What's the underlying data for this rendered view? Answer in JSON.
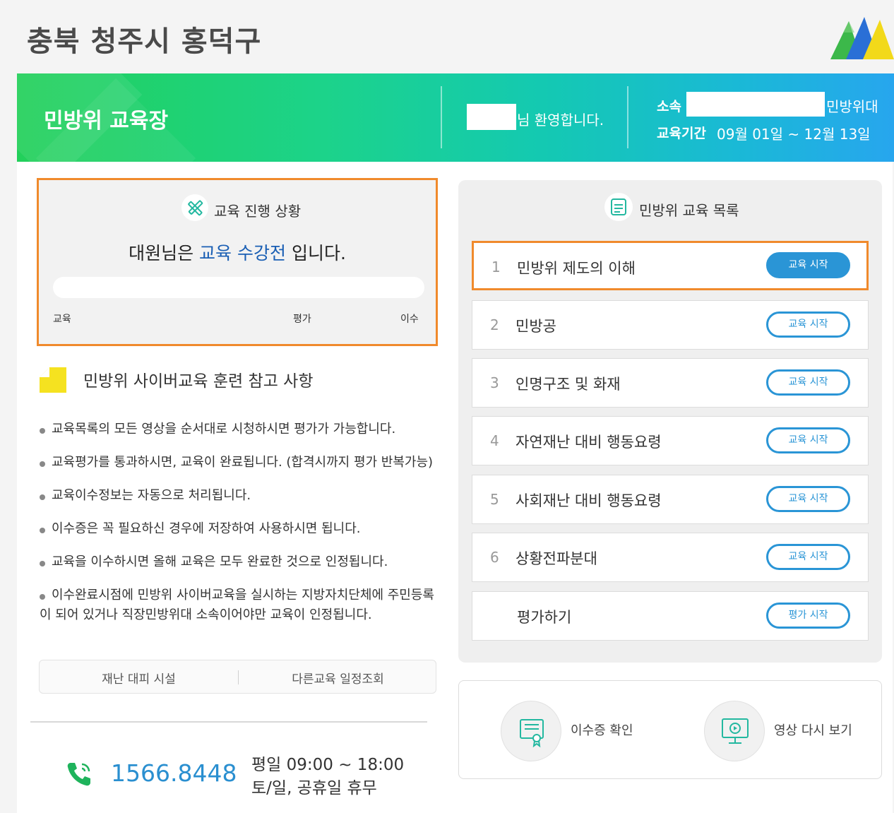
{
  "header": {
    "region": "충북 청주시 홍덕구"
  },
  "banner": {
    "title": "민방위 교육장",
    "welcome_suffix": "님 환영합니다.",
    "affiliation_label": "소속",
    "affiliation_suffix": "민방위대",
    "period_label": "교육기간",
    "period_value": "09월 01일 ~ 12월 13일"
  },
  "progress": {
    "title": "교육 진행 상황",
    "status_prefix": "대원님은 ",
    "status_highlight": "교육 수강전",
    "status_suffix": " 입니다.",
    "fraction": 0,
    "steps": [
      "교육",
      "평가",
      "이수"
    ]
  },
  "notes": {
    "title": "민방위 사이버교육 훈련 참고 사항",
    "items": [
      "교육목록의 모든 영상을 순서대로 시청하시면 평가가 가능합니다.",
      "교육평가를 통과하시면, 교육이 완료됩니다. (합격시까지 평가 반복가능)",
      "교육이수정보는 자동으로 처리됩니다.",
      "이수증은 꼭 필요하신 경우에 저장하여 사용하시면 됩니다.",
      "교육을 이수하시면 올해 교육은 모두 완료한 것으로 인정됩니다.",
      "이수완료시점에 민방위 사이버교육을 실시하는 지방자치단체에 주민등록이 되어 있거나 직장민방위대 소속이어야만 교육이 인정됩니다."
    ]
  },
  "links": {
    "shelter": "재난 대피 시설",
    "schedule": "다른교육 일정조회"
  },
  "contact": {
    "phone": "1566.8448",
    "hours_weekday": "평일 09:00 ~ 18:00",
    "hours_weekend": "토/일, 공휴일 휴무"
  },
  "course_list": {
    "title": "민방위 교육 목록",
    "items": [
      {
        "num": "1",
        "name": "민방위 제도의 이해",
        "button": "교육 시작"
      },
      {
        "num": "2",
        "name": "민방공",
        "button": "교육 시작"
      },
      {
        "num": "3",
        "name": "인명구조 및 화재",
        "button": "교육 시작"
      },
      {
        "num": "4",
        "name": "자연재난 대비 행동요령",
        "button": "교육 시작"
      },
      {
        "num": "5",
        "name": "사회재난 대비 행동요령",
        "button": "교육 시작"
      },
      {
        "num": "6",
        "name": "상황전파분대",
        "button": "교육 시작"
      },
      {
        "num": "",
        "name": "평가하기",
        "button": "평가 시작"
      }
    ]
  },
  "actions": {
    "certificate": "이수증 확인",
    "replay": "영상 다시 보기"
  },
  "colors": {
    "accent": "#2a95d6",
    "highlight_border": "#f08a2c",
    "status_text": "#1a5fb4"
  }
}
